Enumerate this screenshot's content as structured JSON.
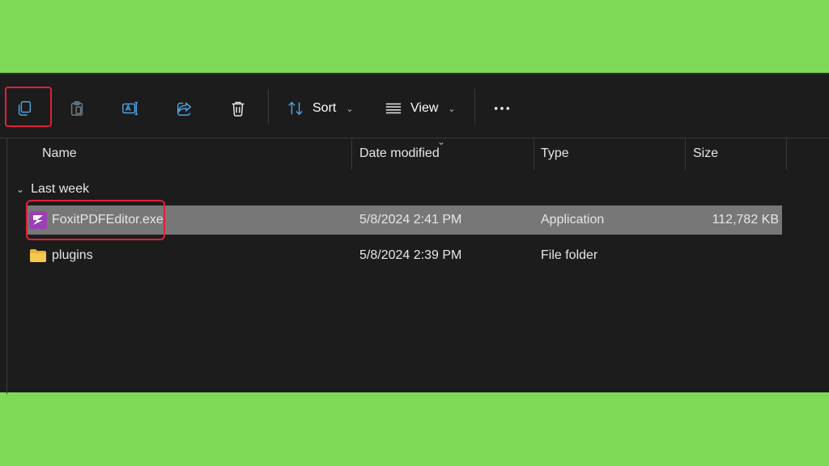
{
  "toolbar": {
    "copy_icon": "copy-icon",
    "paste_icon": "paste-icon",
    "rename_icon": "rename-icon",
    "share_icon": "share-icon",
    "delete_icon": "trash-icon",
    "sort_label": "Sort",
    "view_label": "View",
    "more_icon": "more-horizontal-icon"
  },
  "columns": {
    "name": "Name",
    "date_modified": "Date modified",
    "type": "Type",
    "size": "Size"
  },
  "group": {
    "label": "Last week"
  },
  "files": [
    {
      "name": "FoxitPDFEditor.exe",
      "date_modified": "5/8/2024 2:41 PM",
      "type": "Application",
      "size": "112,782 KB",
      "icon": "foxit-app-icon",
      "selected": true
    },
    {
      "name": "plugins",
      "date_modified": "5/8/2024 2:39 PM",
      "type": "File folder",
      "size": "",
      "icon": "folder-icon",
      "selected": false
    }
  ],
  "colors": {
    "background": "#7ed957",
    "window": "#1c1c1c",
    "selected_row": "#777777",
    "highlight": "#e0203a",
    "icon_accent": "#4aa3e0"
  }
}
